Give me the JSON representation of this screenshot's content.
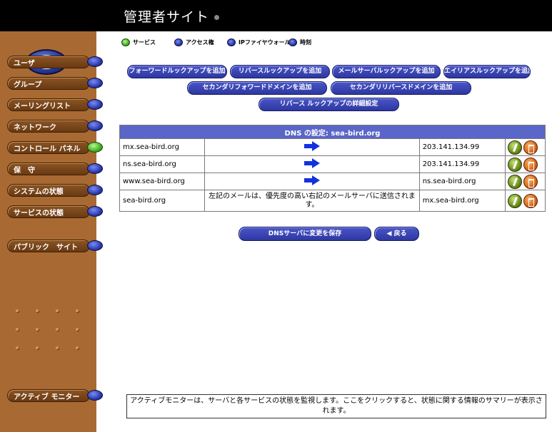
{
  "header": {
    "title": "管理者サイト"
  },
  "sidebar": {
    "items": [
      {
        "label": "ユーザ",
        "active": false
      },
      {
        "label": "グループ",
        "active": false
      },
      {
        "label": "メーリングリスト",
        "active": false
      },
      {
        "label": "ネットワーク",
        "active": false
      },
      {
        "label": "コントロール パネル",
        "active": true
      },
      {
        "label": "保　守",
        "active": false
      },
      {
        "label": "システムの状態",
        "active": false
      },
      {
        "label": "サービスの状態",
        "active": false
      }
    ],
    "public_site_label": "パブリック　サイト",
    "active_monitor_label": "アクティブ モニター"
  },
  "tabs": [
    {
      "label": "サービス",
      "selected": true
    },
    {
      "label": "アクセス権",
      "selected": false
    },
    {
      "label": "IPファイヤウォール",
      "selected": false
    },
    {
      "label": "時刻",
      "selected": false
    }
  ],
  "actions": {
    "add_forward": "フォーワードルックアップを追加",
    "add_reverse": "リバースルックアップを追加",
    "add_mail": "メールサーバルックアップを追加",
    "add_alias": "エイリアスルックアップを追加",
    "add_secondary_forward": "セカンダリフォワードドメインを追加",
    "add_secondary_reverse": "セカンダリリバースドメインを追加",
    "reverse_detail": "リバース ルックアップの詳細設定"
  },
  "table": {
    "title": "DNS の設定: sea-bird.org",
    "rows": [
      {
        "name": "mx.sea-bird.org",
        "target": "203.141.134.99"
      },
      {
        "name": "ns.sea-bird.org",
        "target": "203.141.134.99"
      },
      {
        "name": "www.sea-bird.org",
        "target": "ns.sea-bird.org"
      },
      {
        "name": "sea-bird.org",
        "description": "左記のメールは、優先度の高い右記のメールサーバに送信されます。",
        "target": "mx.sea-bird.org"
      }
    ]
  },
  "footer_buttons": {
    "save": "DNSサーバに変更を保存",
    "back": "戻る"
  },
  "monitor_text": "アクティブモニターは、サーバと各サービスの状態を監視します。ここをクリックすると、状態に関する情報のサマリーが表示されます。",
  "colors": {
    "sidebar": "#a86a32",
    "header": "#000000",
    "button": "#2e37a0",
    "table_header": "#5a66c8",
    "arrow": "#1232e0"
  }
}
